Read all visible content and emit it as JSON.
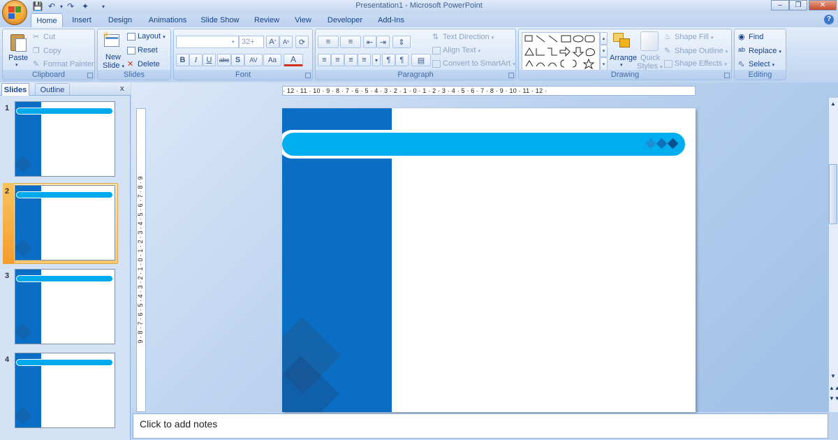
{
  "window": {
    "title": "Presentation1 - Microsoft PowerPoint"
  },
  "tabs": [
    "Home",
    "Insert",
    "Design",
    "Animations",
    "Slide Show",
    "Review",
    "View",
    "Developer",
    "Add-Ins"
  ],
  "ribbon": {
    "clipboard": {
      "label": "Clipboard",
      "paste": "Paste",
      "cut": "Cut",
      "copy": "Copy",
      "format_painter": "Format Painter"
    },
    "slides": {
      "label": "Slides",
      "new_slide_1": "New",
      "new_slide_2": "Slide",
      "layout": "Layout",
      "reset": "Reset",
      "delete": "Delete"
    },
    "font": {
      "label": "Font",
      "font_name": "",
      "font_size": "32+"
    },
    "paragraph": {
      "label": "Paragraph",
      "text_direction": "Text Direction",
      "align_text": "Align Text",
      "convert_smartart": "Convert to SmartArt"
    },
    "drawing": {
      "label": "Drawing",
      "arrange": "Arrange",
      "quick_styles_1": "Quick",
      "quick_styles_2": "Styles",
      "shape_fill": "Shape Fill",
      "shape_outline": "Shape Outline",
      "shape_effects": "Shape Effects"
    },
    "editing": {
      "label": "Editing",
      "find": "Find",
      "replace": "Replace",
      "select": "Select"
    }
  },
  "pane": {
    "tab_slides": "Slides",
    "tab_outline": "Outline",
    "close": "x",
    "slide_numbers": [
      "1",
      "2",
      "3",
      "4"
    ],
    "selected_slide": 2
  },
  "ruler": {
    "horizontal": "· 12 · 11 · 10 · 9 · 8 · 7 · 6 · 5 · 4 · 3 · 2 · 1 · 0 · 1 · 2 · 3 · 4 · 5 · 6 · 7 · 8 · 9 · 10 · 11 · 12 ·",
    "vertical": "9 · 8 · 7 · 6 · 5 · 4 · 3 · 2 · 1 · 0 · 1 · 2 · 3 · 4 · 5 · 6 · 7 · 8 · 9"
  },
  "notes": {
    "placeholder": "Click to add notes"
  },
  "colors": {
    "slide_blue": "#0a6fc4",
    "slide_cyan": "#00aeef",
    "selection": "#ffc870"
  }
}
